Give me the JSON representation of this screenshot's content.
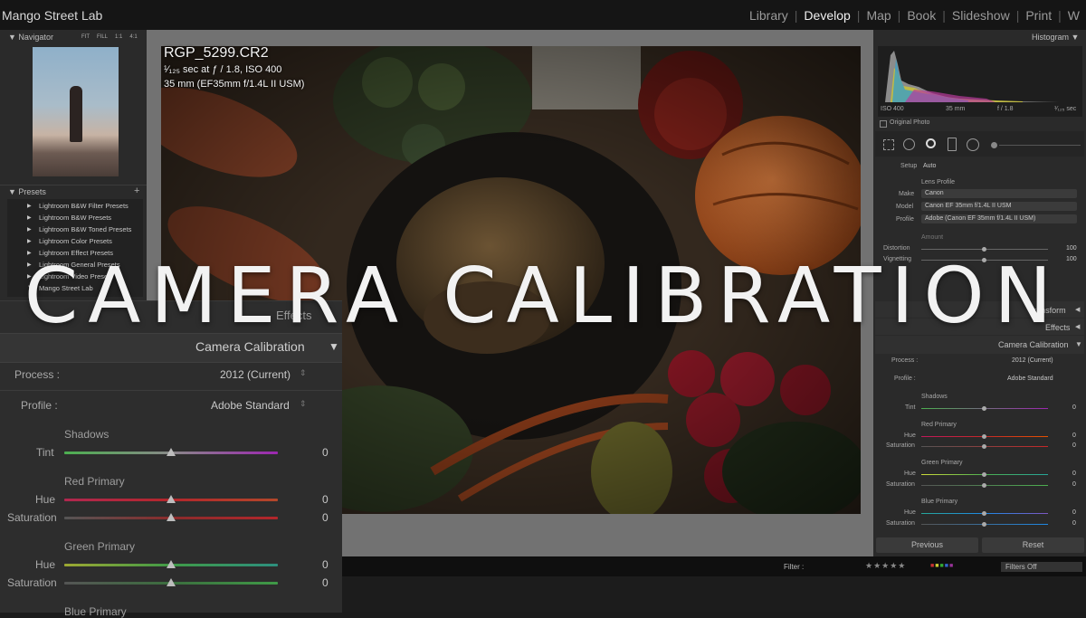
{
  "app": {
    "brand": "Mango Street Lab",
    "modules": [
      {
        "label": "Library",
        "active": false
      },
      {
        "label": "Develop",
        "active": true
      },
      {
        "label": "Map",
        "active": false
      },
      {
        "label": "Book",
        "active": false
      },
      {
        "label": "Slideshow",
        "active": false
      },
      {
        "label": "Print",
        "active": false
      },
      {
        "label": "W",
        "active": false
      }
    ]
  },
  "navigator": {
    "title": "Navigator",
    "zoom_options": [
      "FIT",
      "FILL",
      "1:1",
      "4:1"
    ]
  },
  "presets": {
    "title": "Presets",
    "add": "+",
    "items": [
      "Lightroom B&W Filter Presets",
      "Lightroom B&W Presets",
      "Lightroom B&W Toned Presets",
      "Lightroom Color Presets",
      "Lightroom Effect Presets",
      "Lightroom General Presets",
      "Lightroom Video Presets",
      "Mango Street Lab"
    ]
  },
  "photo_info": {
    "filename": "RGP_5299.CR2",
    "exposure": "¹⁄₁₂₅ sec at ƒ / 1.8, ISO 400",
    "lens": "35 mm (EF35mm f/1.4L II USM)"
  },
  "overlay_title": "CAMERA CALIBRATION",
  "histogram": {
    "title": "Histogram",
    "iso": "ISO 400",
    "focal": "35 mm",
    "aperture": "f / 1.8",
    "shutter": "¹⁄₁₂₅ sec",
    "original_photo": "Original Photo"
  },
  "lens_panel": {
    "setup_label": "Setup",
    "setup_value": "Auto",
    "lens_profile": "Lens Profile",
    "make_label": "Make",
    "make_value": "Canon",
    "model_label": "Model",
    "model_value": "Canon EF 35mm f/1.4L II USM",
    "profile_label": "Profile",
    "profile_value": "Adobe (Canon EF 35mm f/1.4L II USM)",
    "amount": "Amount",
    "distortion_label": "Distortion",
    "distortion_value": "100",
    "vignetting_label": "Vignetting",
    "vignetting_value": "100"
  },
  "right_sections": {
    "transform": "Transform",
    "effects": "Effects",
    "camera_calibration": "Camera Calibration"
  },
  "calibration_small": {
    "process_label": "Process :",
    "process_value": "2012 (Current)",
    "profile_label": "Profile :",
    "profile_value": "Adobe Standard",
    "shadows": "Shadows",
    "tint": "Tint",
    "red_primary": "Red Primary",
    "green_primary": "Green Primary",
    "blue_primary": "Blue Primary",
    "hue": "Hue",
    "saturation": "Saturation",
    "zero": "0"
  },
  "buttons": {
    "previous": "Previous",
    "reset": "Reset"
  },
  "filter_bar": {
    "filter_label": "Filter :",
    "filters_off": "Filters Off"
  },
  "calibration_zoom": {
    "effects": "Effects",
    "title": "Camera Calibration",
    "process_label": "Process :",
    "process_value": "2012 (Current)",
    "profile_label": "Profile :",
    "profile_value": "Adobe Standard",
    "shadows": "Shadows",
    "tint_label": "Tint",
    "tint_value": "0",
    "red_primary": "Red Primary",
    "red_hue_label": "Hue",
    "red_hue_value": "0",
    "red_sat_label": "Saturation",
    "red_sat_value": "0",
    "green_primary": "Green Primary",
    "green_hue_label": "Hue",
    "green_hue_value": "0",
    "green_sat_label": "Saturation",
    "green_sat_value": "0",
    "blue_primary": "Blue Primary"
  }
}
